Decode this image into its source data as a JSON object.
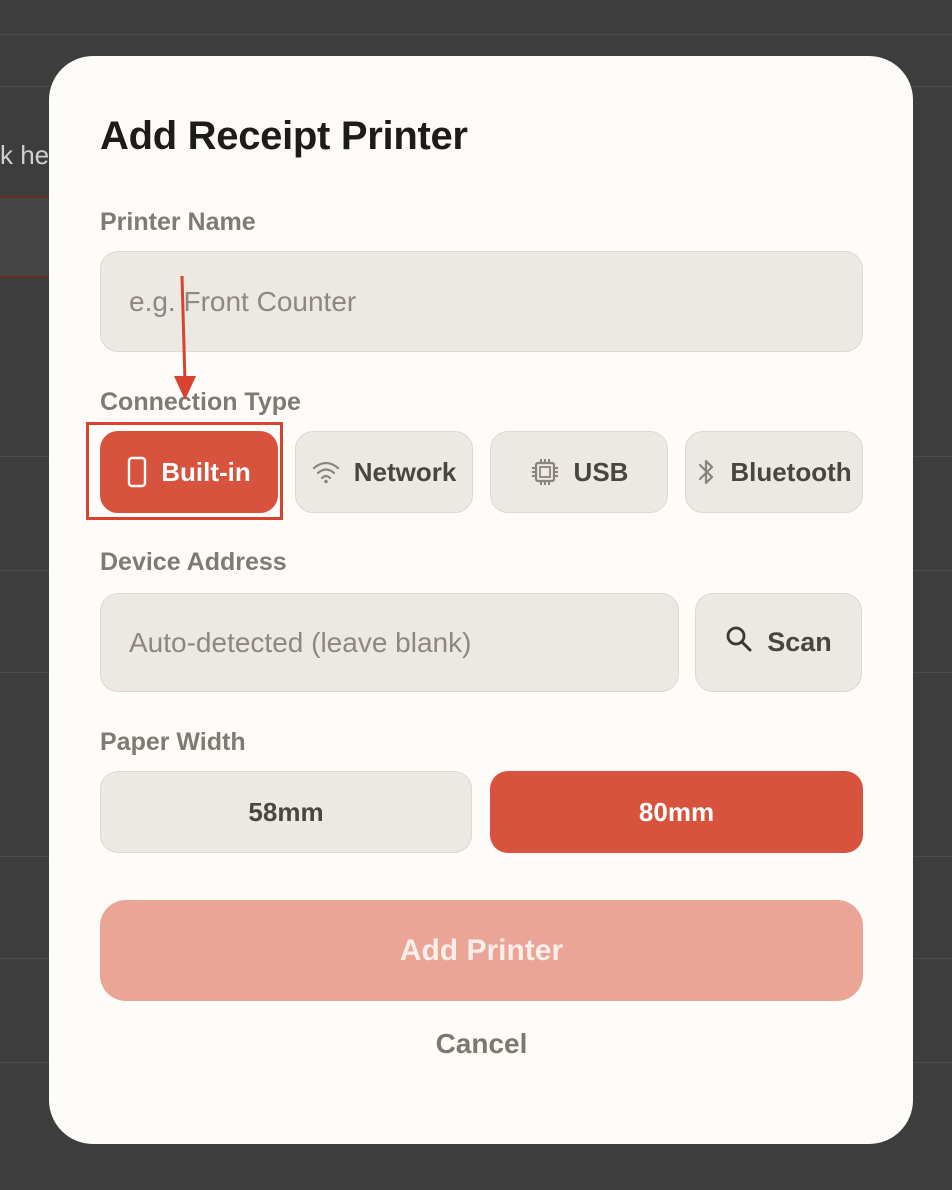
{
  "background": {
    "partial_text": "k he"
  },
  "dialog": {
    "title": "Add Receipt Printer",
    "printer_name": {
      "label": "Printer Name",
      "placeholder": "e.g. Front Counter",
      "value": ""
    },
    "connection_type": {
      "label": "Connection Type",
      "options": [
        {
          "label": "Built-in",
          "icon": "phone-icon",
          "selected": true
        },
        {
          "label": "Network",
          "icon": "wifi-icon",
          "selected": false
        },
        {
          "label": "USB",
          "icon": "chip-icon",
          "selected": false
        },
        {
          "label": "Bluetooth",
          "icon": "bluetooth-icon",
          "selected": false
        }
      ]
    },
    "device_address": {
      "label": "Device Address",
      "placeholder": "Auto-detected (leave blank)",
      "value": "",
      "scan_label": "Scan"
    },
    "paper_width": {
      "label": "Paper Width",
      "options": [
        {
          "label": "58mm",
          "selected": false
        },
        {
          "label": "80mm",
          "selected": true
        }
      ]
    },
    "add_button_label": "Add Printer",
    "cancel_label": "Cancel"
  },
  "colors": {
    "accent": "#d8533d",
    "accent_disabled": "#eaa597",
    "input_bg": "#ece9e2",
    "dialog_bg": "#fdfcf8",
    "annotation": "#d8432f"
  }
}
